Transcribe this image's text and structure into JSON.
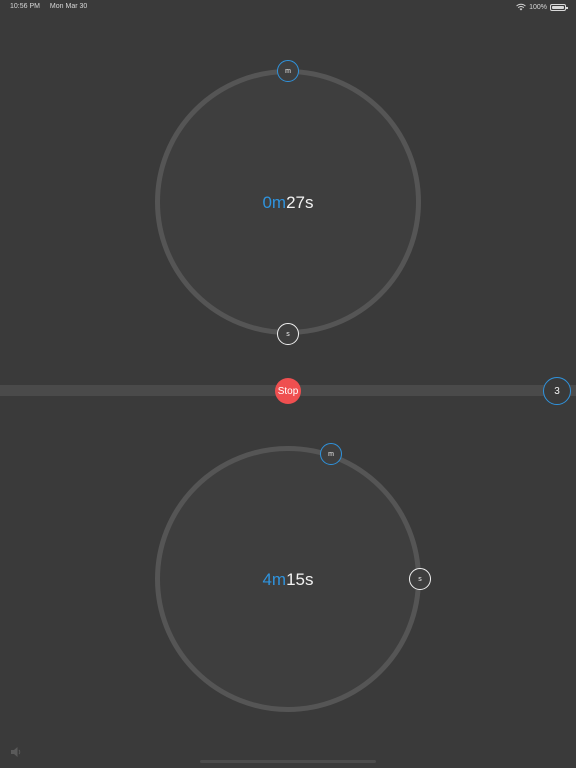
{
  "status_bar": {
    "time": "10:56 PM",
    "date": "Mon Mar 30",
    "battery": "100%"
  },
  "top_timer": {
    "minutes": "0m",
    "seconds": "27s",
    "minute_knob_label": "m",
    "second_knob_label": "s"
  },
  "bottom_timer": {
    "minutes": "4m",
    "seconds": "15s",
    "minute_knob_label": "m",
    "second_knob_label": "s"
  },
  "controls": {
    "stop_label": "Stop",
    "count": "3"
  },
  "colors": {
    "accent": "#2f93dd",
    "stop": "#ef4f50",
    "background": "#3a3a3a",
    "ring": "#555555"
  },
  "icons": {
    "wifi": "wifi-icon",
    "battery": "battery-icon",
    "speaker": "speaker-icon"
  }
}
